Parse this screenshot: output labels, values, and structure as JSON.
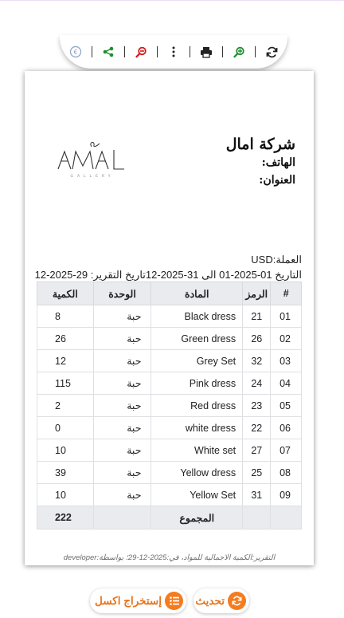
{
  "toolbar": {
    "icons": [
      "logo-badge-icon",
      "share-icon",
      "zoom-out-icon",
      "more-vertical-icon",
      "print-icon",
      "zoom-in-icon",
      "refresh-icon"
    ],
    "colors": {
      "green": "#1e8f2e",
      "red": "#d7191c",
      "dark": "#222222"
    }
  },
  "report": {
    "company_name": "شركة امال",
    "phone_label": "الهاتف:",
    "address_label": "العنوان:",
    "logo_text": "AMAL",
    "logo_subtext": "GALLERY",
    "currency_line": "العملة:USD",
    "date_line": "التاريخ 01-2025-01 الى 31-2025-12تاريخ التقرير: 29-2025-12",
    "headers": {
      "num": "#",
      "code": "الرمز",
      "material": "المادة",
      "unit": "الوحدة",
      "qty": "الكمية"
    },
    "rows": [
      {
        "num": "01",
        "code": "21",
        "material": "Black dress",
        "unit": "حبة",
        "qty": "8"
      },
      {
        "num": "02",
        "code": "26",
        "material": "Green dress",
        "unit": "حبة",
        "qty": "26"
      },
      {
        "num": "03",
        "code": "32",
        "material": "Grey Set",
        "unit": "حبة",
        "qty": "12"
      },
      {
        "num": "04",
        "code": "24",
        "material": "Pink dress",
        "unit": "حبة",
        "qty": "115"
      },
      {
        "num": "05",
        "code": "23",
        "material": "Red dress",
        "unit": "حبة",
        "qty": "2"
      },
      {
        "num": "06",
        "code": "22",
        "material": "white dress",
        "unit": "حبة",
        "qty": "0"
      },
      {
        "num": "07",
        "code": "27",
        "material": "White set",
        "unit": "حبة",
        "qty": "10"
      },
      {
        "num": "08",
        "code": "25",
        "material": "Yellow dress",
        "unit": "حبة",
        "qty": "39"
      },
      {
        "num": "09",
        "code": "31",
        "material": "Yellow Set",
        "unit": "حبة",
        "qty": "10"
      }
    ],
    "total_label": "المجموع",
    "total_qty": "222",
    "footer": "التقرير:الكمية الاجمالية للمواد، في:2025-12-29؛ بواسطة:developer"
  },
  "buttons": {
    "refresh_label": "تحديث",
    "export_label": "إستخراج اكسل",
    "accent": "#f47b1f"
  }
}
